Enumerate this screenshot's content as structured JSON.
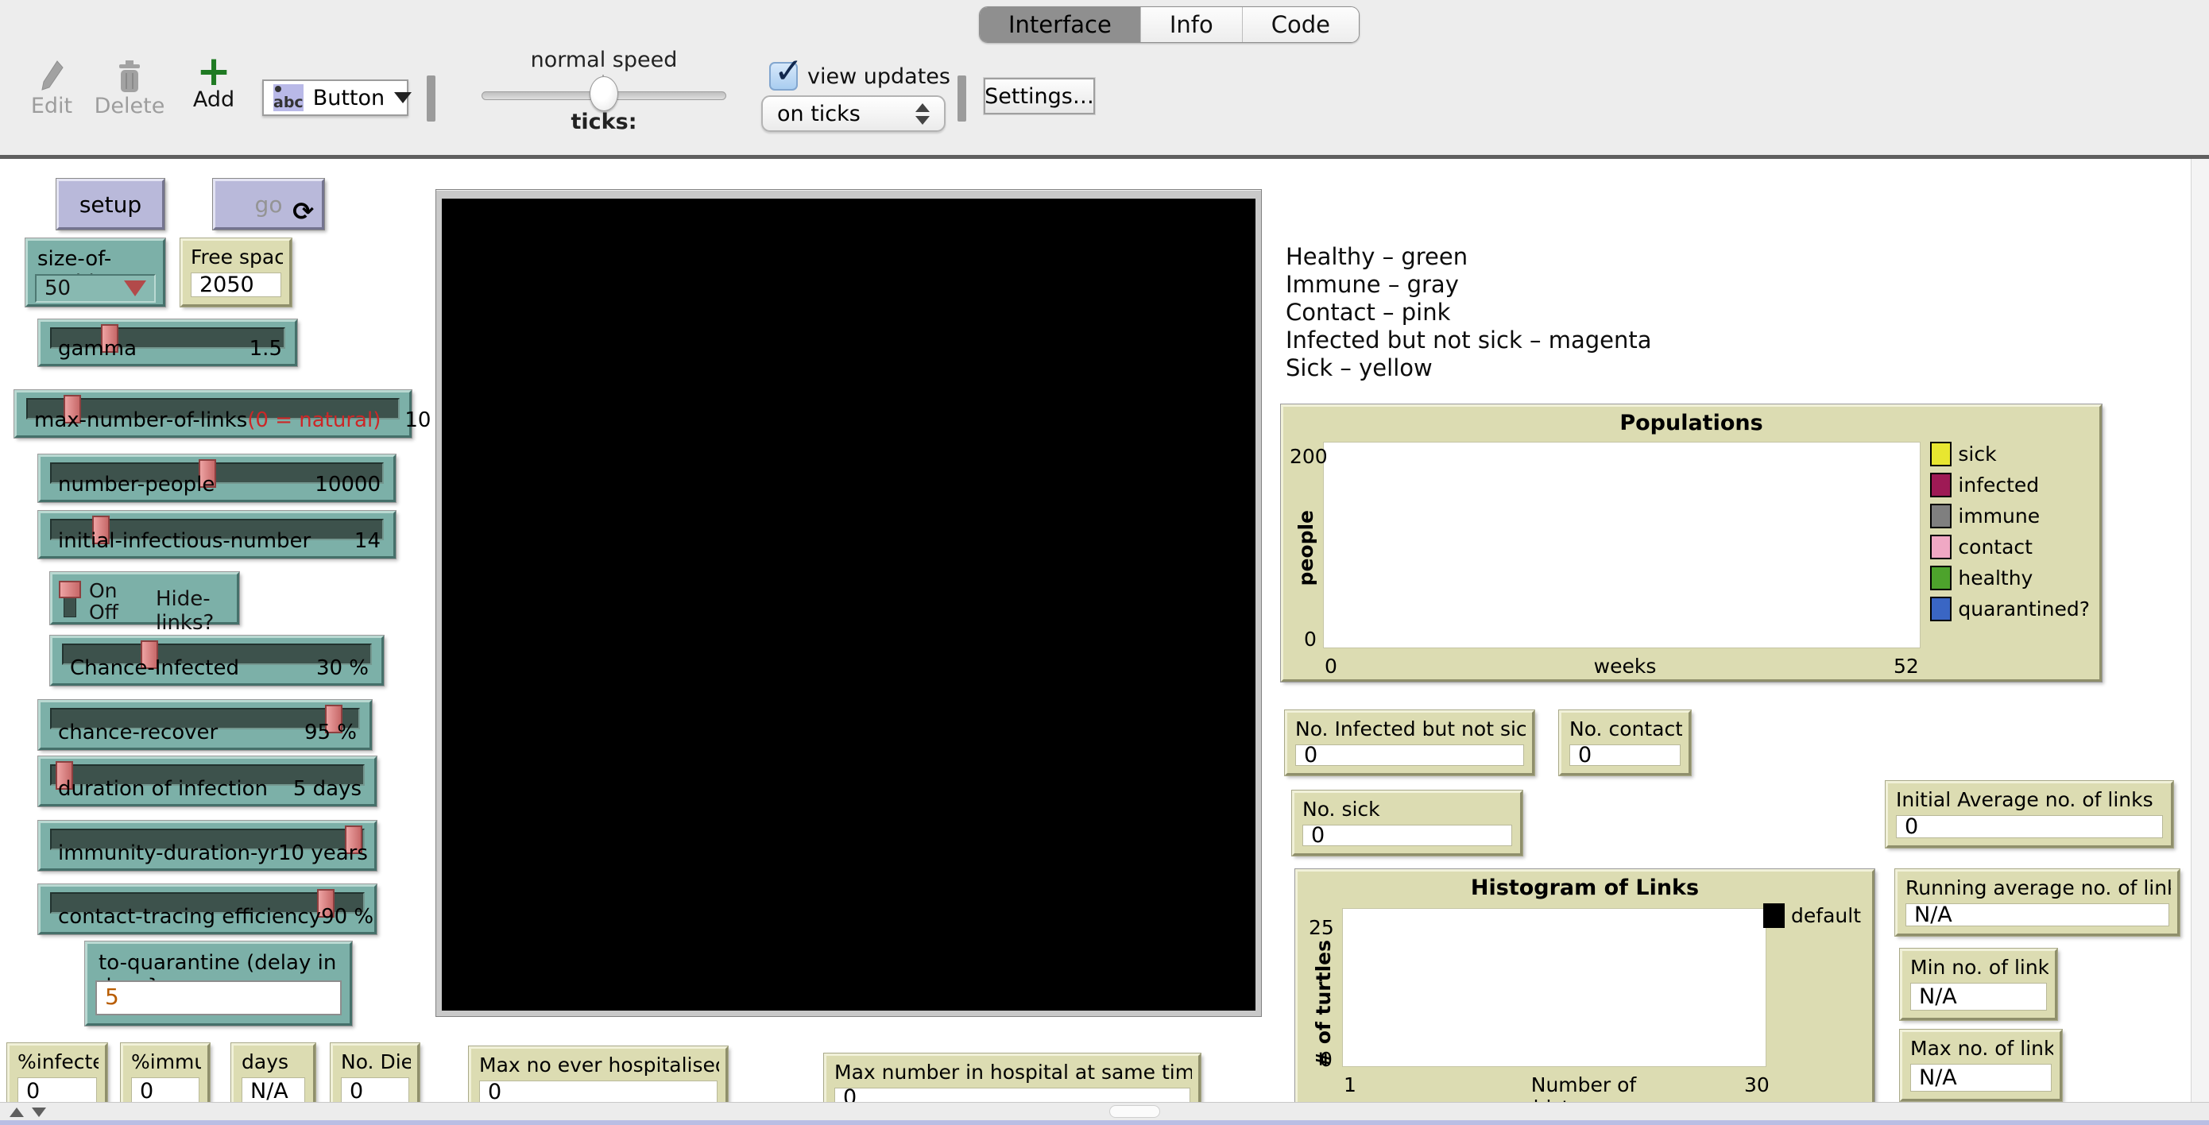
{
  "toolbar": {
    "tabs": [
      {
        "label": "Interface",
        "selected": true
      },
      {
        "label": "Info",
        "selected": false
      },
      {
        "label": "Code",
        "selected": false
      }
    ],
    "edit_label": "Edit",
    "delete_label": "Delete",
    "add_label": "Add",
    "widget_type_selector": {
      "icon": "abc",
      "value": "Button"
    },
    "speed": {
      "label": "normal speed",
      "ticks_label": "ticks:"
    },
    "view_updates_label": "view updates",
    "update_mode": {
      "value": "on ticks"
    },
    "settings_label": "Settings…"
  },
  "buttons": {
    "setup": "setup",
    "go": "go"
  },
  "chooser": {
    "label": "size-of-world",
    "value": "50"
  },
  "sliders": [
    {
      "label": "gamma",
      "value": "1.5"
    },
    {
      "label": "max-number-of-links",
      "note": "(0 = natural)",
      "value": "10"
    },
    {
      "label": "number-people",
      "value": "10000"
    },
    {
      "label": "initial-infectious-number",
      "value": "14"
    },
    {
      "label": "Chance-Infected",
      "value": "30 %"
    },
    {
      "label": "chance-recover",
      "value": "95 %"
    },
    {
      "label": "duration of infection",
      "value": "5 days"
    },
    {
      "label": "immunity-duration-yr",
      "value": "10 years"
    },
    {
      "label": "contact-tracing efficiency",
      "value": "90 %"
    }
  ],
  "switch": {
    "on_label": "On",
    "off_label": "Off",
    "label": "Hide-links?",
    "state": "On"
  },
  "input": {
    "label": "to-quarantine (delay in days}",
    "value": "5"
  },
  "monitors": {
    "free_space": {
      "label": "Free space",
      "value": "2050"
    },
    "pct_infected": {
      "label": "%infected",
      "value": "0"
    },
    "pct_immune": {
      "label": "%immune",
      "value": "0"
    },
    "days": {
      "label": "days",
      "value": "N/A"
    },
    "no_died": {
      "label": "No. Died",
      "value": "0"
    },
    "max_hospitalised": {
      "label": "Max no ever hospitalised",
      "value": "0"
    },
    "max_in_hospital": {
      "label": "Max number in hospital at same time",
      "value": "0"
    },
    "no_infected_not_sick": {
      "label": "No. Infected but not sick",
      "value": "0"
    },
    "no_contacts": {
      "label": "No. contacts",
      "value": "0"
    },
    "no_sick": {
      "label": "No. sick",
      "value": "0"
    },
    "initial_avg_links": {
      "label": "Initial Average no. of links",
      "value": "0"
    },
    "running_avg_links": {
      "label": "Running average no. of links",
      "value": "N/A"
    },
    "min_links": {
      "label": "Min no. of links",
      "value": "N/A"
    },
    "max_links": {
      "label": "Max no. of links",
      "value": "N/A"
    }
  },
  "color_key_lines": [
    "Healthy – green",
    "Immune – gray",
    "Contact – pink",
    "Infected but not sick – magenta",
    "Sick – yellow"
  ],
  "chart_data": [
    {
      "type": "line",
      "title": "Populations",
      "xlabel": "weeks",
      "ylabel": "people",
      "xlim": [
        0,
        52
      ],
      "ylim": [
        0,
        200
      ],
      "grid": false,
      "legend_position": "right",
      "series": [
        {
          "name": "sick",
          "color": "#e8e630",
          "x": [],
          "y": []
        },
        {
          "name": "infected",
          "color": "#9e1a55",
          "x": [],
          "y": []
        },
        {
          "name": "immune",
          "color": "#7f7f7f",
          "x": [],
          "y": []
        },
        {
          "name": "contact",
          "color": "#f0a8c4",
          "x": [],
          "y": []
        },
        {
          "name": "healthy",
          "color": "#4da32c",
          "x": [],
          "y": []
        },
        {
          "name": "quarantined?",
          "color": "#3a66c4",
          "x": [],
          "y": []
        }
      ],
      "note": "plot is empty (model not yet run)"
    },
    {
      "type": "bar",
      "title": "Histogram of Links",
      "xlabel": "Number of histogram",
      "ylabel": "# of turtles",
      "xlim": [
        1,
        30
      ],
      "ylim": [
        0,
        25
      ],
      "grid": false,
      "legend_position": "top-right",
      "series": [
        {
          "name": "default",
          "color": "#000000",
          "x": [],
          "y": []
        }
      ],
      "note": "plot is empty (model not yet run)"
    }
  ]
}
